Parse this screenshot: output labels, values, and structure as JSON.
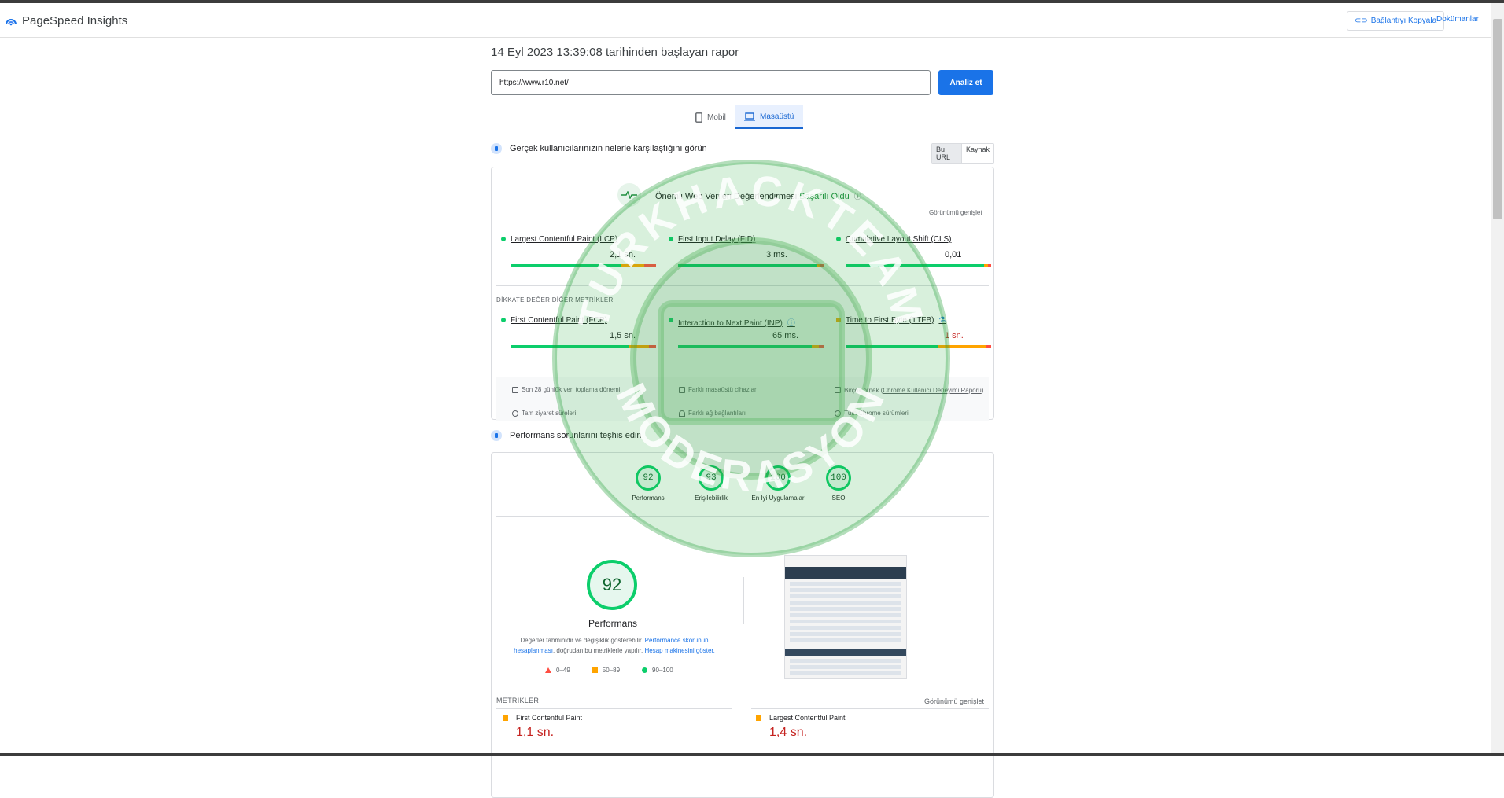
{
  "header": {
    "app_name": "PageSpeed Insights",
    "copy_link_label": "Bağlantıyı Kopyala",
    "docs_label": "Dokümanlar"
  },
  "report": {
    "title": "14 Eyl 2023 13:39:08 tarihinden başlayan rapor",
    "url_value": "https://www.r10.net/",
    "analyze_label": "Analiz et",
    "tabs": [
      {
        "label": "Mobil",
        "active": false
      },
      {
        "label": "Masaüstü",
        "active": true
      }
    ]
  },
  "field": {
    "heading": "Gerçek kullanıcılarınızın nelerle karşılaştığını görün",
    "toggle": [
      "Bu URL",
      "Kaynak"
    ],
    "cwv_label": "Önemli Web Verileri Değerlendirmesi:",
    "cwv_status": "Başarılı Oldu",
    "expand_label": "Görünümü genişlet",
    "other_metrics_label": "DİKKATE DEĞER DİĞER METRİKLER",
    "core_metrics": [
      {
        "name": "Largest Contentful Paint (LCP)",
        "value": "2,1 sn."
      },
      {
        "name": "First Input Delay (FID)",
        "value": "3 ms."
      },
      {
        "name": "Cumulative Layout Shift (CLS)",
        "value": "0,01"
      }
    ],
    "other_metrics": [
      {
        "name": "First Contentful Paint (FCP)",
        "value": "1,5 sn."
      },
      {
        "name": "Interaction to Next Paint (INP)",
        "value": "65 ms."
      },
      {
        "name": "Time to First Byte (TTFB)",
        "value": "1 sn."
      }
    ],
    "info": {
      "period": "Son 28 günlük veri toplama dönemi",
      "devices": "Farklı masaüstü cihazlar",
      "samples_prefix": "Birçok örnek (",
      "samples_link": "Chrome Kullanıcı Deneyimi Raporu",
      "samples_suffix": ")",
      "visits": "Tam ziyaret süreleri",
      "network": "Farklı ağ bağlantıları",
      "chrome": "Tüm Chrome sürümleri"
    }
  },
  "lab": {
    "heading": "Performans sorunlarını teşhis edin",
    "scores": [
      {
        "label": "Performans",
        "value": "92"
      },
      {
        "label": "Erişilebilirlik",
        "value": "93"
      },
      {
        "label": "En İyi Uygulamalar",
        "value": "100"
      },
      {
        "label": "SEO",
        "value": "100"
      }
    ],
    "main_score": "92",
    "main_label": "Performans",
    "note_prefix": "Değerler tahminidir ve değişiklik gösterebilir. ",
    "note_link1": "Performance skorunun hesaplanması",
    "note_mid": ", doğrudan bu metriklerle yapılır. ",
    "note_link2": "Hesap makinesini göster.",
    "legend": [
      "0–49",
      "50–89",
      "90–100"
    ],
    "metrics_label": "METRİKLER",
    "expand_label": "Görünümü genişlet",
    "bottom_metrics": [
      {
        "name": "First Contentful Paint",
        "value": "1,1 sn."
      },
      {
        "name": "Largest Contentful Paint",
        "value": "1,4 sn."
      }
    ]
  },
  "watermark": {
    "top_text": "TURKHACKTEAM",
    "bottom_text": "MODERASYON"
  },
  "colors": {
    "accent": "#1a73e8",
    "pass": "#0cce6b",
    "average": "#ffa400",
    "fail": "#ff4e42"
  }
}
